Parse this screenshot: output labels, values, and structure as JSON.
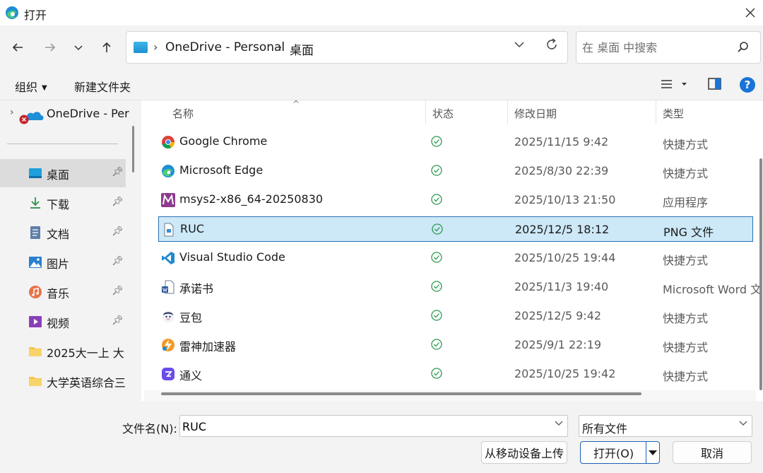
{
  "window": {
    "title": "打开"
  },
  "address": {
    "crumbs": [
      "OneDrive - Personal",
      "桌面"
    ]
  },
  "search": {
    "placeholder": "在 桌面 中搜索"
  },
  "commands": {
    "organize": "组织",
    "new_folder": "新建文件夹"
  },
  "sidebar": {
    "root": "OneDrive - Per",
    "items": [
      {
        "label": "桌面",
        "icon": "desktop-icon",
        "pinned": true,
        "active": true
      },
      {
        "label": "下载",
        "icon": "download-icon",
        "pinned": true
      },
      {
        "label": "文档",
        "icon": "document-icon",
        "pinned": true
      },
      {
        "label": "图片",
        "icon": "pictures-icon",
        "pinned": true
      },
      {
        "label": "音乐",
        "icon": "music-icon",
        "pinned": true
      },
      {
        "label": "视频",
        "icon": "video-icon",
        "pinned": true
      },
      {
        "label": "2025大一上  大",
        "icon": "folder-icon"
      },
      {
        "label": "大学英语综合三",
        "icon": "folder-icon"
      }
    ]
  },
  "columns": {
    "name": "名称",
    "status": "状态",
    "modified": "修改日期",
    "type": "类型"
  },
  "files": [
    {
      "name": "Google Chrome",
      "date": "2025/11/15 9:42",
      "type": "快捷方式",
      "icon": "chrome-icon"
    },
    {
      "name": "Microsoft Edge",
      "date": "2025/8/30 22:39",
      "type": "快捷方式",
      "icon": "edge-icon"
    },
    {
      "name": "msys2-x86_64-20250830",
      "date": "2025/10/13 21:50",
      "type": "应用程序",
      "icon": "msys2-icon"
    },
    {
      "name": "RUC",
      "date": "2025/12/5 18:12",
      "type": "PNG 文件",
      "icon": "png-file-icon",
      "selected": true
    },
    {
      "name": "Visual Studio Code",
      "date": "2025/10/25 19:44",
      "type": "快捷方式",
      "icon": "vscode-icon"
    },
    {
      "name": "承诺书",
      "date": "2025/11/3 19:40",
      "type": "Microsoft Word 文",
      "icon": "word-icon"
    },
    {
      "name": "豆包",
      "date": "2025/12/5 9:42",
      "type": "快捷方式",
      "icon": "doubao-icon"
    },
    {
      "name": "雷神加速器",
      "date": "2025/9/1 22:19",
      "type": "快捷方式",
      "icon": "leishen-icon"
    },
    {
      "name": "通义",
      "date": "2025/10/25 19:42",
      "type": "快捷方式",
      "icon": "tongyi-icon"
    }
  ],
  "bottom": {
    "filename_label": "文件名(N):",
    "filename_value": "RUC",
    "filter_value": "所有文件",
    "upload_label": "从移动设备上传",
    "open_label": "打开(O)",
    "cancel_label": "取消"
  },
  "colors": {
    "accent": "#1c62b4",
    "selection": "#cde8f7",
    "status_ok": "#2e9a52"
  }
}
